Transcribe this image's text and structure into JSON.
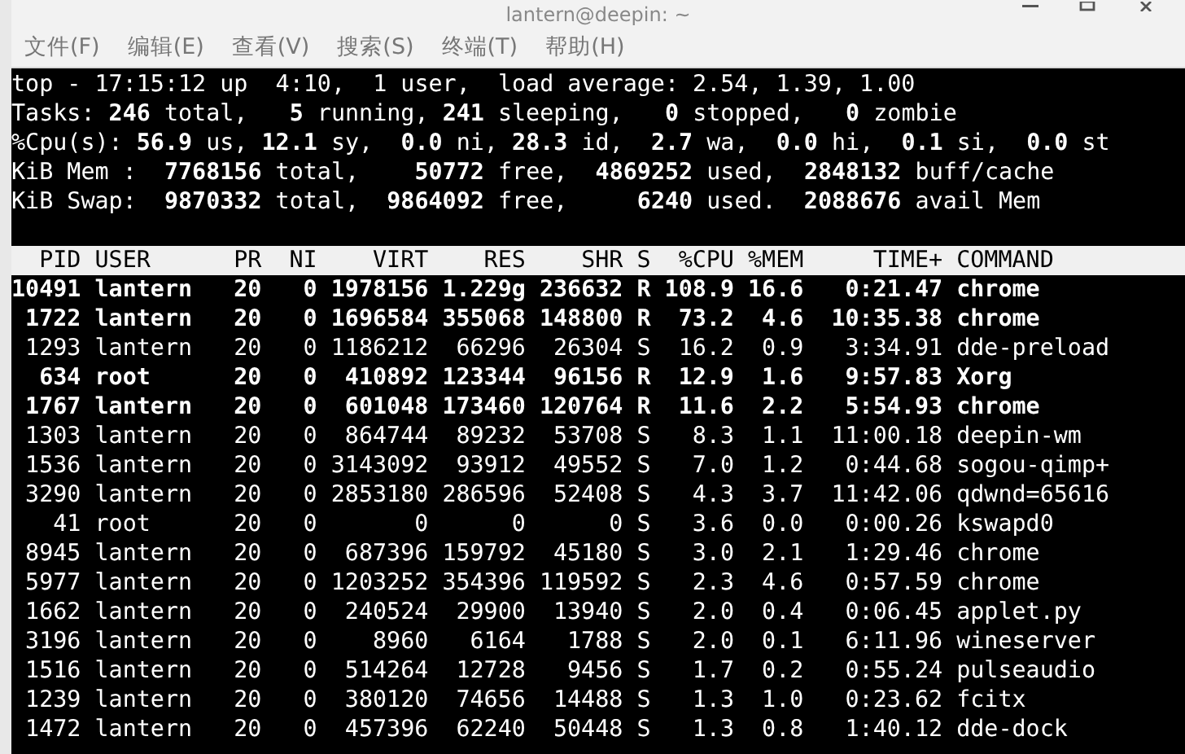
{
  "window": {
    "title": "lantern@deepin: ~"
  },
  "menu": [
    "文件(F)",
    "编辑(E)",
    "查看(V)",
    "搜索(S)",
    "终端(T)",
    "帮助(H)"
  ],
  "summary": [
    "top - 17:15:12 up  4:10,  1 user,  load average: 2.54, 1.39, 1.00",
    "Tasks: **246** total,   **5** running, **241** sleeping,   **0** stopped,   **0** zombie",
    "%Cpu(s): **56.9** us, **12.1** sy,  **0.0** ni, **28.3** id,  **2.7** wa,  **0.0** hi,  **0.1** si,  **0.0** st",
    "KiB Mem :  **7768156** total,    **50772** free,  **4869252** used,  **2848132** buff/cache",
    "KiB Swap:  **9870332** total,  **9864092** free,     **6240** used.  **2088676** avail Mem"
  ],
  "table": {
    "columns": [
      "PID",
      "USER",
      "PR",
      "NI",
      "VIRT",
      "RES",
      "SHR",
      "S",
      "%CPU",
      "%MEM",
      "TIME+",
      "COMMAND"
    ],
    "rows": [
      {
        "highlighted": true,
        "cells": [
          "10491",
          "lantern",
          "20",
          "0",
          "1978156",
          "1.229g",
          "236632",
          "R",
          "108.9",
          "16.6",
          "0:21.47",
          "chrome"
        ]
      },
      {
        "highlighted": true,
        "cells": [
          "1722",
          "lantern",
          "20",
          "0",
          "1696584",
          "355068",
          "148800",
          "R",
          "73.2",
          "4.6",
          "10:35.38",
          "chrome"
        ]
      },
      {
        "highlighted": false,
        "cells": [
          "1293",
          "lantern",
          "20",
          "0",
          "1186212",
          "66296",
          "26304",
          "S",
          "16.2",
          "0.9",
          "3:34.91",
          "dde-preload"
        ]
      },
      {
        "highlighted": true,
        "cells": [
          "634",
          "root",
          "20",
          "0",
          "410892",
          "123344",
          "96156",
          "R",
          "12.9",
          "1.6",
          "9:57.83",
          "Xorg"
        ]
      },
      {
        "highlighted": true,
        "cells": [
          "1767",
          "lantern",
          "20",
          "0",
          "601048",
          "173460",
          "120764",
          "R",
          "11.6",
          "2.2",
          "5:54.93",
          "chrome"
        ]
      },
      {
        "highlighted": false,
        "cells": [
          "1303",
          "lantern",
          "20",
          "0",
          "864744",
          "89232",
          "53708",
          "S",
          "8.3",
          "1.1",
          "11:00.18",
          "deepin-wm"
        ]
      },
      {
        "highlighted": false,
        "cells": [
          "1536",
          "lantern",
          "20",
          "0",
          "3143092",
          "93912",
          "49552",
          "S",
          "7.0",
          "1.2",
          "0:44.68",
          "sogou-qimp+"
        ]
      },
      {
        "highlighted": false,
        "cells": [
          "3290",
          "lantern",
          "20",
          "0",
          "2853180",
          "286596",
          "52408",
          "S",
          "4.3",
          "3.7",
          "11:42.06",
          "qdwnd=65616"
        ]
      },
      {
        "highlighted": false,
        "cells": [
          "41",
          "root",
          "20",
          "0",
          "0",
          "0",
          "0",
          "S",
          "3.6",
          "0.0",
          "0:00.26",
          "kswapd0"
        ]
      },
      {
        "highlighted": false,
        "cells": [
          "8945",
          "lantern",
          "20",
          "0",
          "687396",
          "159792",
          "45180",
          "S",
          "3.0",
          "2.1",
          "1:29.46",
          "chrome"
        ]
      },
      {
        "highlighted": false,
        "cells": [
          "5977",
          "lantern",
          "20",
          "0",
          "1203252",
          "354396",
          "119592",
          "S",
          "2.3",
          "4.6",
          "0:57.59",
          "chrome"
        ]
      },
      {
        "highlighted": false,
        "cells": [
          "1662",
          "lantern",
          "20",
          "0",
          "240524",
          "29900",
          "13940",
          "S",
          "2.0",
          "0.4",
          "0:06.45",
          "applet.py"
        ]
      },
      {
        "highlighted": false,
        "cells": [
          "3196",
          "lantern",
          "20",
          "0",
          "8960",
          "6164",
          "1788",
          "S",
          "2.0",
          "0.1",
          "6:11.96",
          "wineserver"
        ]
      },
      {
        "highlighted": false,
        "cells": [
          "1516",
          "lantern",
          "20",
          "0",
          "514264",
          "12728",
          "9456",
          "S",
          "1.7",
          "0.2",
          "0:55.24",
          "pulseaudio"
        ]
      },
      {
        "highlighted": false,
        "cells": [
          "1239",
          "lantern",
          "20",
          "0",
          "380120",
          "74656",
          "14488",
          "S",
          "1.3",
          "1.0",
          "0:23.62",
          "fcitx"
        ]
      },
      {
        "highlighted": false,
        "cells": [
          "1472",
          "lantern",
          "20",
          "0",
          "457396",
          "62240",
          "50448",
          "S",
          "1.3",
          "0.8",
          "1:40.12",
          "dde-dock"
        ]
      }
    ]
  }
}
